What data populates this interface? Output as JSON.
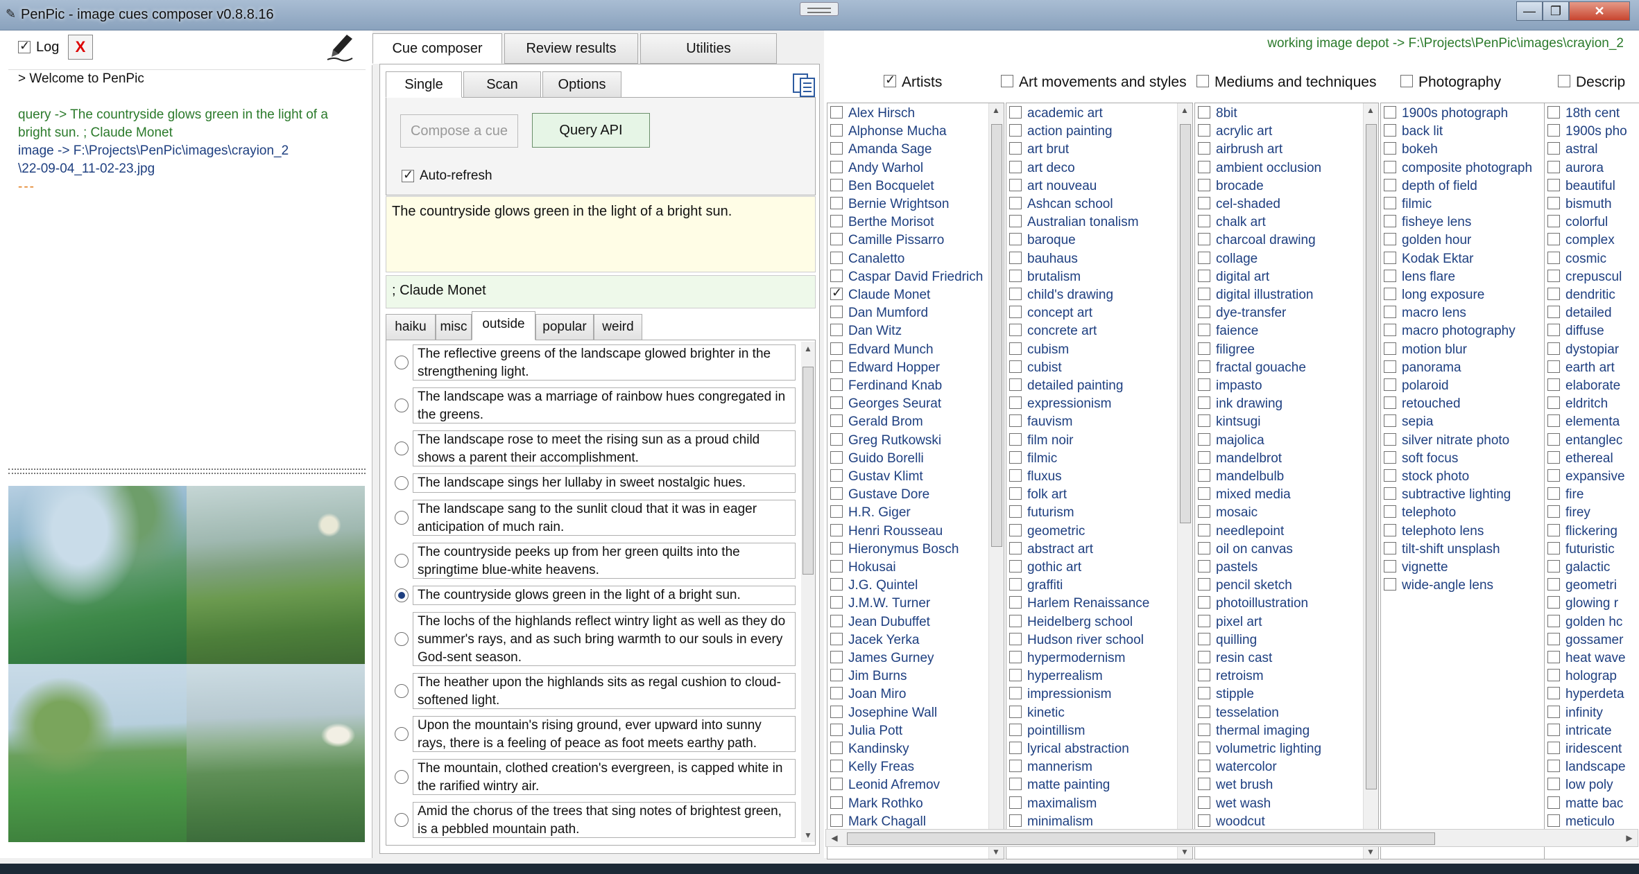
{
  "window": {
    "title": "PenPic - image cues composer v0.8.8.16"
  },
  "log": {
    "log_label": "Log",
    "clear_label": "X",
    "welcome": "> Welcome to PenPic",
    "query_line1": "query -> The countryside glows green in the light of a",
    "query_line2": "bright sun. ; Claude Monet",
    "image_line1": "image -> F:\\Projects\\PenPic\\images\\crayion_2",
    "image_line2": "\\22-09-04_11-02-23.jpg",
    "separator": "---"
  },
  "tabs": {
    "cue": "Cue composer",
    "review": "Review results",
    "utilities": "Utilities"
  },
  "subtabs": {
    "single": "Single",
    "scan": "Scan",
    "options": "Options"
  },
  "single": {
    "compose": "Compose a cue",
    "query": "Query API",
    "auto_refresh": "Auto-refresh"
  },
  "cue_text": "The countryside glows green in the light of a bright sun.",
  "artist_text": "; Claude Monet",
  "phrase_tabs": [
    "haiku",
    "misc",
    "outside",
    "popular",
    "weird"
  ],
  "phrases": [
    {
      "text": "The reflective greens of the landscape glowed brighter in the strengthening light.",
      "selected": false
    },
    {
      "text": "The landscape was a marriage of rainbow hues congregated in the greens.",
      "selected": false
    },
    {
      "text": "The landscape rose to meet the rising sun as a proud child shows a parent their accomplishment.",
      "selected": false
    },
    {
      "text": "The landscape sings her lullaby in sweet nostalgic hues.",
      "selected": false
    },
    {
      "text": "The landscape sang to the sunlit cloud that it was in eager anticipation of much rain.",
      "selected": false
    },
    {
      "text": "The countryside peeks up from her green quilts into the springtime blue-white heavens.",
      "selected": false
    },
    {
      "text": "The countryside glows green in the light of a bright sun.",
      "selected": true
    },
    {
      "text": "The lochs of the highlands reflect wintry light as well as they do summer's rays, and as such bring warmth to our souls in every God-sent season.",
      "selected": false
    },
    {
      "text": "The heather upon the highlands sits as regal cushion to cloud-softened light.",
      "selected": false
    },
    {
      "text": "Upon the mountain's rising ground, ever upward into sunny rays, there is a feeling of peace as foot meets earthy path.",
      "selected": false
    },
    {
      "text": "The mountain, clothed creation's evergreen, is capped white in the rarified wintry air.",
      "selected": false
    },
    {
      "text": "Amid the chorus of the trees that sing notes of brightest green, is a pebbled mountain path.",
      "selected": false
    }
  ],
  "depot": "working image depot -> F:\\Projects\\PenPic\\images\\crayion_2",
  "categories": [
    {
      "name": "Artists",
      "checked": true
    },
    {
      "name": "Art movements and styles",
      "checked": false
    },
    {
      "name": "Mediums and techniques",
      "checked": false
    },
    {
      "name": "Photography",
      "checked": false
    },
    {
      "name": "Descrip",
      "checked": false
    }
  ],
  "artists": [
    "Alex Hirsch",
    "Alphonse Mucha",
    "Amanda Sage",
    "Andy Warhol",
    "Ben Bocquelet",
    "Bernie Wrightson",
    "Berthe Morisot",
    "Camille Pissarro",
    "Canaletto",
    "Caspar David Friedrich",
    "Claude Monet",
    "Dan Mumford",
    "Dan Witz",
    "Edvard Munch",
    "Edward Hopper",
    "Ferdinand Knab",
    "Georges Seurat",
    "Gerald Brom",
    "Greg Rutkowski",
    "Guido Borelli",
    "Gustav Klimt",
    "Gustave Dore",
    "H.R. Giger",
    "Henri Rousseau",
    "Hieronymus Bosch",
    "Hokusai",
    "J.G. Quintel",
    "J.M.W. Turner",
    "Jean Dubuffet",
    "Jacek Yerka",
    "James Gurney",
    "Jim Burns",
    "Joan Miro",
    "Josephine Wall",
    "Julia Pott",
    "Kandinsky",
    "Kelly Freas",
    "Leonid Afremov",
    "Mark Rothko",
    "Mark Chagall"
  ],
  "artists_checked": [
    "Claude Monet"
  ],
  "movements": [
    "academic art",
    "action painting",
    "art brut",
    "art deco",
    "art nouveau",
    "Ashcan school",
    "Australian tonalism",
    "baroque",
    "bauhaus",
    "brutalism",
    "child's drawing",
    "concept art",
    "concrete art",
    "cubism",
    "cubist",
    "detailed painting",
    "expressionism",
    "fauvism",
    "film noir",
    "filmic",
    "fluxus",
    "folk art",
    "futurism",
    "geometric",
    "abstract art",
    "gothic art",
    "graffiti",
    "Harlem Renaissance",
    "Heidelberg school",
    "Hudson river school",
    "hypermodernism",
    "hyperrealism",
    "impressionism",
    "kinetic",
    "pointillism",
    "lyrical abstraction",
    "mannerism",
    "matte painting",
    "maximalism",
    "minimalism"
  ],
  "mediums": [
    "8bit",
    "acrylic art",
    "airbrush art",
    "ambient occlusion",
    "brocade",
    "cel-shaded",
    "chalk art",
    "charcoal drawing",
    "collage",
    "digital art",
    "digital illustration",
    "dye-transfer",
    "faience",
    "filigree",
    "fractal gouache",
    "impasto",
    "ink drawing",
    "kintsugi",
    "majolica",
    "mandelbrot",
    "mandelbulb",
    "mixed media",
    "mosaic",
    "needlepoint",
    "oil on canvas",
    "pastels",
    "pencil sketch",
    "photoillustration",
    "pixel art",
    "quilling",
    "resin cast",
    "retroism",
    "stipple",
    "tesselation",
    "thermal imaging",
    "volumetric lighting",
    "watercolor",
    "wet brush",
    "wet wash",
    "woodcut"
  ],
  "photography": [
    "1900s photograph",
    "back lit",
    "bokeh",
    "composite photograph",
    "depth of field",
    "filmic",
    "fisheye lens",
    "golden hour",
    "Kodak Ektar",
    "lens flare",
    "long exposure",
    "macro lens",
    "macro photography",
    "motion blur",
    "panorama",
    "polaroid",
    "retouched",
    "sepia",
    "silver nitrate photo",
    "soft focus",
    "stock photo",
    "subtractive lighting",
    "telephoto",
    "telephoto lens",
    "tilt-shift unsplash",
    "vignette",
    "wide-angle lens"
  ],
  "descriptive": [
    "18th cent",
    "1900s pho",
    "astral",
    "aurora",
    "beautiful",
    "bismuth",
    "colorful",
    "complex",
    "cosmic",
    "crepuscul",
    "dendritic",
    "detailed",
    "diffuse",
    "dystopiar",
    "earth art",
    "elaborate",
    "eldritch",
    "elementa",
    "entanglec",
    "ethereal",
    "expansive",
    "fire",
    "firey",
    "flickering",
    "futuristic",
    "galactic",
    "geometri",
    "glowing r",
    "golden hc",
    "gossamer",
    "heat wave",
    "holograp",
    "hyperdeta",
    "infinity",
    "intricate",
    "iridescent",
    "landscape",
    "low poly",
    "matte bac",
    "meticulo"
  ]
}
